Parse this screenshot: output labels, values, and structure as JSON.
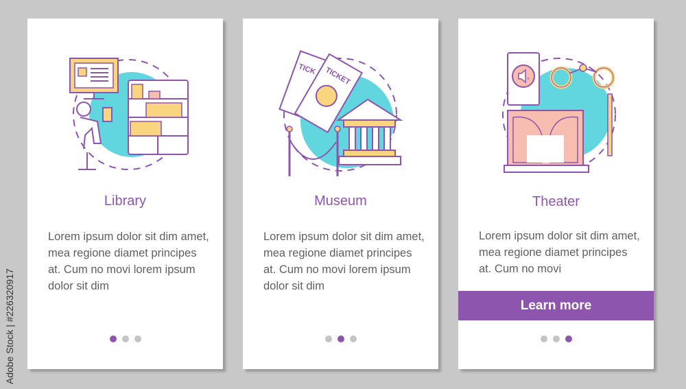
{
  "watermark": {
    "text": "Adobe Stock | #226320917"
  },
  "colors": {
    "accent": "#8d55ad",
    "teal": "#62d6de",
    "yellow": "#f8d57e",
    "pink": "#f6bdb0",
    "inactive_dot": "#c4c4c4"
  },
  "cards": [
    {
      "illustration": "library-reader-icon",
      "title": "Library",
      "body": "Lorem ipsum dolor sit dim amet, mea regione diamet principes at. Cum no movi lorem ipsum dolor sit dim",
      "active_page": 1,
      "pages": 3
    },
    {
      "illustration": "museum-tickets-icon",
      "title": "Museum",
      "body": "Lorem ipsum dolor sit dim amet, mea regione diamet principes at. Cum no movi lorem ipsum dolor sit dim",
      "active_page": 2,
      "pages": 3
    },
    {
      "illustration": "theater-stage-icon",
      "title": "Theater",
      "body": "Lorem ipsum dolor sit dim amet, mea regione diamet principes at. Cum no movi",
      "button": "Learn more",
      "active_page": 3,
      "pages": 3,
      "ticket_labels": []
    }
  ],
  "museum_ticket_labels": [
    "TICK",
    "TICKET"
  ]
}
